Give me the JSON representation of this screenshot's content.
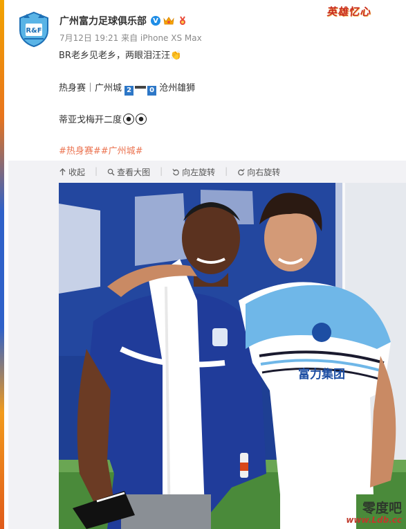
{
  "post": {
    "username": "广州富力足球俱乐部",
    "verified_badge": "V",
    "meta": "7月12日 19:21 来自 iPhone XS Max",
    "line1": "BR老乡见老乡，两眼泪汪汪👏",
    "match": {
      "prefix": "热身赛｜广州城",
      "home_score": "2",
      "away_score": "0",
      "away_team": "沧州雄狮"
    },
    "line3": "蒂亚戈梅开二度",
    "hashtags": "#热身赛##广州城#"
  },
  "toolbar": {
    "collapse": "收起",
    "view_large": "查看大图",
    "rotate_left": "向左旋转",
    "rotate_right": "向右旋转"
  },
  "photo": {
    "shirt_text": "富力集团",
    "badge_text": "R&F"
  },
  "watermarks": {
    "top_right": "英雄忆心",
    "bottom_site": "www.Ldb.cc",
    "bottom_chars": "零度吧"
  },
  "colors": {
    "hashtag": "#eb7350",
    "verified": "#1f8de6",
    "score_box": "#2d77c7",
    "text": "#333333",
    "meta": "#8a8a8a"
  }
}
